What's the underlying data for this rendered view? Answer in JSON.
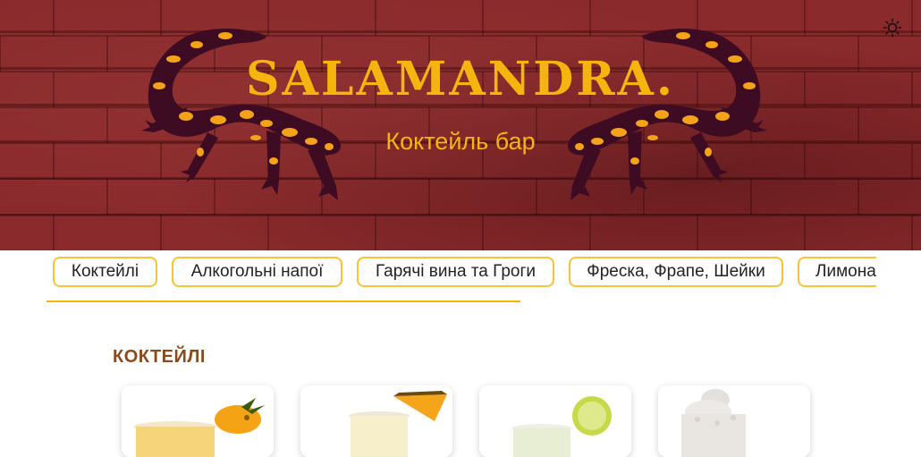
{
  "hero": {
    "brand": "SALAMANDRA.",
    "subtitle": "Коктейль бар",
    "theme_icon": "sun-icon",
    "accent": "#f6b40e",
    "background": "#8a2a2c"
  },
  "nav": {
    "items": [
      {
        "label": "Коктейлі"
      },
      {
        "label": "Алкогольні напої"
      },
      {
        "label": "Гарячі вина та Гроги"
      },
      {
        "label": "Фреска, Фрапе, Шейки"
      },
      {
        "label": "Лимонади"
      }
    ],
    "border_color": "#f6c33a"
  },
  "section": {
    "title": "КОКТЕЙЛІ",
    "title_color": "#8b4a1c"
  },
  "cards": [
    {
      "image": "pineapple-cocktail-image"
    },
    {
      "image": "pina-colada-image"
    },
    {
      "image": "lime-cocktail-image"
    },
    {
      "image": "whipped-cream-shake-image"
    }
  ]
}
